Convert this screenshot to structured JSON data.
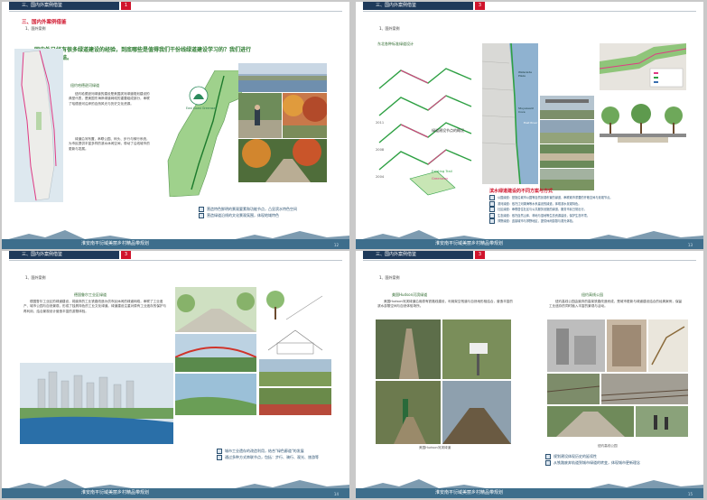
{
  "footer_title": "淮安南平衍域美丽乡村精品带规划",
  "chapter_title": "三、国内外案例借鉴",
  "pages": [
    {
      "num": "1",
      "section": "三、国内外案例借鉴",
      "subsection": "1、国外案例",
      "headline": "国内外已经有很多绿道建设的经验，到底哪些是值得我们干份线绿道建设学习的？我们进行了分析与总结。",
      "case_title": "纽约哈德逊河绿道",
      "paragraph1": "纽约哈德逊河绿道的建设是美国滨河绿道规划建设的典型代表，是美国东海岸绿道网络的重要组成部分，串联了哈德逊河沿岸的自然风光与历史文化资源。",
      "paragraph2": "绿道沿河布置，串联公园、码头、步行与骑行系统，为市民提供丰富多样的滨水休闲空间，带动了沿线城市的更新与发展。",
      "map_badge": "East Coast Greenway",
      "notes": [
        "营造特色鲜明的景观要素和功能节点，凸显滨水特色空间",
        "营造绿道沿线的文化景观氛围，体现地域特色"
      ],
      "page_no": "12"
    },
    {
      "num": "3",
      "section": "三、国内外案例借鉴",
      "subsection": "1、国外案例",
      "case_title": "东北各种标准绿道设计",
      "caption_title": "绿道建设节点的概况",
      "map_labels": [
        "Waterside Plaza",
        "Stuyvesant Cove",
        "East River",
        "2011",
        "2008",
        "2004",
        "Existing Trail",
        "Greenway"
      ],
      "red_title": "滨水绿道建设的不同方案与方式",
      "notes": [
        "公园绿道：是指沿城市公园等自然景观布置的绿道，串联城市重要的开敞空间与景观节点。",
        "滨河绿道：依托江河湖海等水系建设的绿道，体现滨水景观特色。",
        "社区绿道：串联居住社区与公共服务设施的绿道，服务市民日常出行。",
        "生态绿道：依托自然山体、林地与湿地等生态资源建设，保护生态环境。",
        "郊野绿道：连接城市与郊野地区，提供休闲游憩与观光体验。",
        "城市绿道：位于城市建成区内，串联城市重要节点与功能区。",
        "历史绿道：依托历史文化遗存建设，展示城市历史文化内涵。"
      ],
      "page_no": "13"
    },
    {
      "num": "3",
      "section": "三、国内外案例借鉴",
      "subsection": "1、国外案例",
      "case_title": "德国鲁尔工业区绿道",
      "paragraph": "德国鲁尔工业区的绿道建设，将废弃的工业铁路改造为供市民休闲的绿道网络，串联了工业遗产、城市公园与自然景观，形成了独具特色的工业文化绿道。绿道建设注重对原有工业遗存的保护与再利用，结合景观设计营造丰富的游憩体验。",
      "notes": [
        "城市工业遗存的改造利用，结合\"绿色廊道\"的发展",
        "通过多种方式串联节点，包括：步行、骑行、观光、旅游等"
      ],
      "page_no": "14"
    },
    {
      "num": "3",
      "section": "三、国内外案例借鉴",
      "subsection": "1、国外案例",
      "case_left_title": "美国Hudson河滨绿道",
      "case_left_para": "美国Hudson河滨绿道沿用原有铁路线建设，利用架空栈道与自然地形相结合，营造丰富的滨水游憩空间与自然体验场所。",
      "case_right_title": "纽约高线公园",
      "case_right_para": "纽约高线公园由废弃的高架铁路改造而成，是城市更新与绿道建设结合的经典案例，保留工业遗存的同时植入丰富的景观与活动。",
      "photo_caption_left": "美国Hudson河滨绿道",
      "photo_caption_right": "纽约高线公园",
      "notes": [
        "规划建设体现历史的延续性",
        "从铁路废弃轨道到城市绿道的转变，体现城市更新理念"
      ],
      "page_no": "15"
    }
  ],
  "colors": {
    "header_dark": "#1f3a5a",
    "accent_red": "#d0142c",
    "footer_band": "#3e6e8c",
    "green_headline": "#2e7d32"
  }
}
